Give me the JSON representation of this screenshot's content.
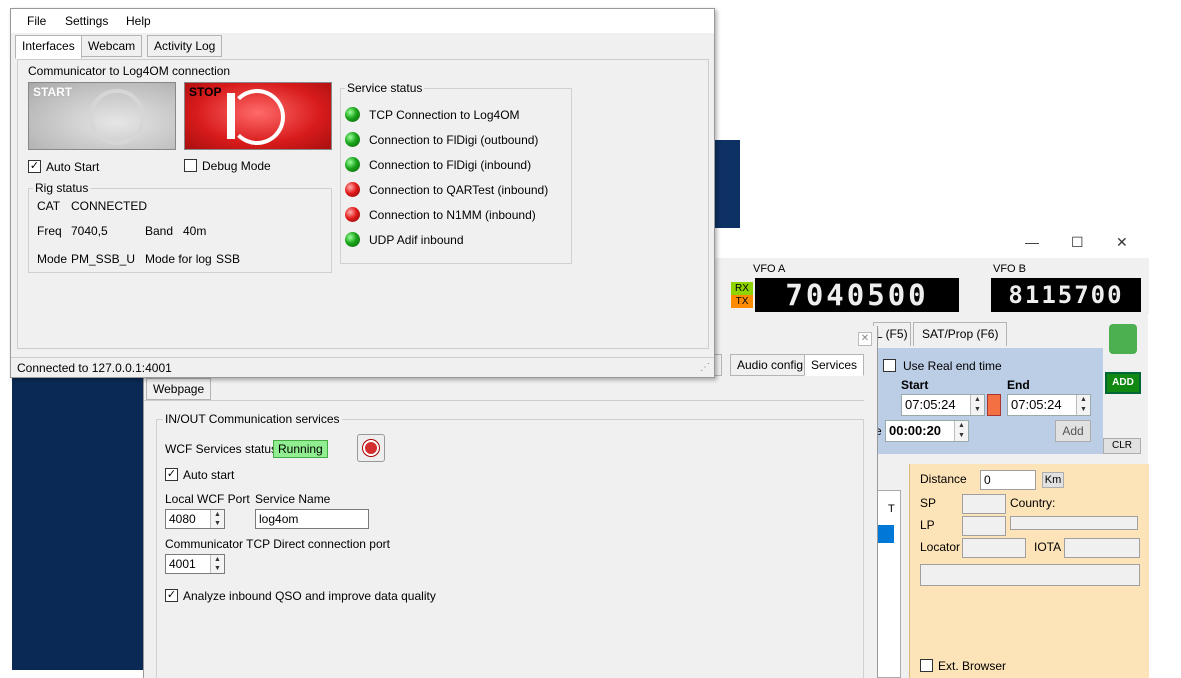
{
  "communicator": {
    "menu": [
      "File",
      "Settings",
      "Help"
    ],
    "tabs": [
      "Interfaces",
      "Webcam",
      "Activity Log"
    ],
    "connection_group_title": "Communicator to Log4OM connection",
    "start_label": "START",
    "stop_label": "STOP",
    "auto_start_label": "Auto Start",
    "auto_start_checked": true,
    "debug_mode_label": "Debug Mode",
    "debug_mode_checked": false,
    "rig_status_title": "Rig status",
    "cat_label": "CAT",
    "cat_value": "CONNECTED",
    "freq_label": "Freq",
    "freq_value": "7040,5",
    "band_label": "Band",
    "band_value": "40m",
    "mode_label": "Mode",
    "mode_value": "PM_SSB_U",
    "mode_for_log_label": "Mode for log",
    "mode_for_log_value": "SSB",
    "service_status_title": "Service status",
    "services": [
      {
        "label": "TCP Connection to Log4OM",
        "status": "green"
      },
      {
        "label": "Connection to FlDigi (outbound)",
        "status": "green"
      },
      {
        "label": "Connection to FlDigi (inbound)",
        "status": "green"
      },
      {
        "label": "Connection to QARTest (inbound)",
        "status": "red"
      },
      {
        "label": "Connection to N1MM (inbound)",
        "status": "red"
      },
      {
        "label": "UDP Adif inbound",
        "status": "green"
      }
    ],
    "status_bar": "Connected to 127.0.0.1:4001"
  },
  "services_window": {
    "tabs": [
      "e",
      "Audio config",
      "Services",
      "Webpage"
    ],
    "group_title": "IN/OUT Communication services",
    "wcf_status_label": "WCF Services status",
    "wcf_status_value": "Running",
    "auto_start_label": "Auto start",
    "local_wcf_port_label": "Local WCF Port",
    "local_wcf_port_value": "4080",
    "service_name_label": "Service Name",
    "service_name_value": "log4om",
    "tcp_port_label": "Communicator TCP Direct connection port",
    "tcp_port_value": "4001",
    "analyze_label": "Analyze inbound QSO and improve data quality"
  },
  "logger": {
    "vfo_a_label": "VFO A",
    "vfo_a_value": "7040500",
    "vfo_b_label": "VFO B",
    "vfo_b_value": "8115700",
    "rx_label": "RX",
    "tx_label": "TX",
    "tabs": [
      "L (F5)",
      "SAT/Prop (F6)"
    ],
    "use_real_end_time_label": "Use Real end time",
    "start_label": "Start",
    "end_label": "End",
    "start_time": "07:05:24",
    "end_time": "07:05:24",
    "duration_prefix": "e",
    "duration_value": "00:00:20",
    "add_small_label": "Add",
    "add_label": "ADD",
    "clr_label": "CLR",
    "distance_label": "Distance",
    "distance_value": "0",
    "km_label": "Km",
    "sp_label": "SP",
    "country_label": "Country:",
    "lp_label": "LP",
    "locator_label": "Locator",
    "iota_label": "IOTA",
    "ext_browser_label": "Ext. Browser",
    "list_header": "T"
  },
  "colors": {
    "accent_blue": "#bccde6",
    "panel_orange": "#fce3b8",
    "running_green": "#90ee90",
    "desktop_blue": "#0a2a55"
  }
}
